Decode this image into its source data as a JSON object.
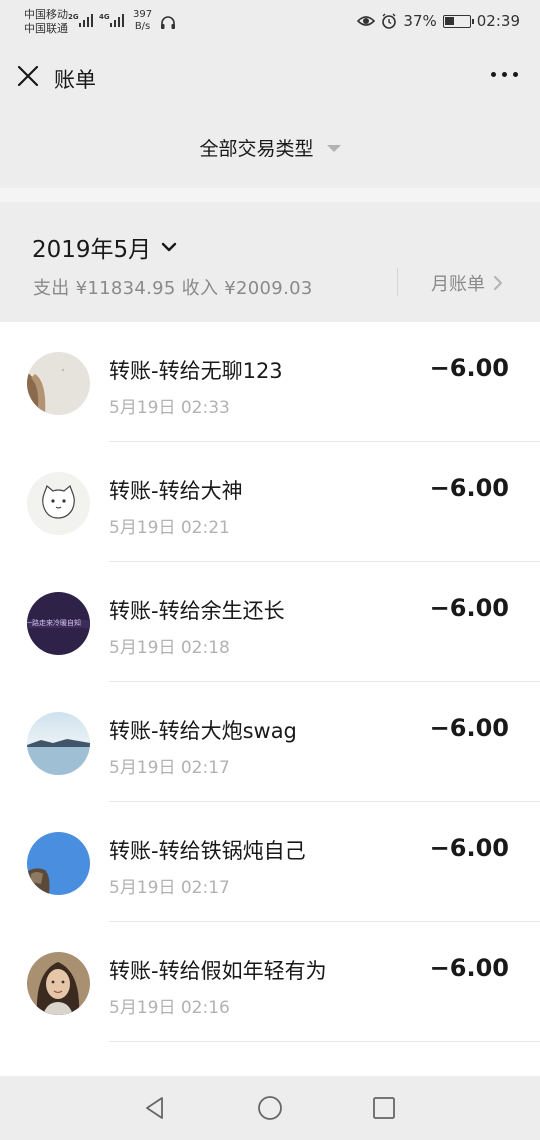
{
  "status_bar": {
    "carrier1": "中国移动",
    "carrier2": "中国联通",
    "net1": "2G",
    "net2": "4G",
    "speed_value": "397",
    "speed_unit": "B/s",
    "battery": "37%",
    "time": "02:39",
    "battery_level": 0.37
  },
  "nav": {
    "title": "账单",
    "close_icon": "close-icon",
    "more_icon": "more-icon"
  },
  "filter": {
    "label": "全部交易类型"
  },
  "month": {
    "label": "2019年5月",
    "summary": "支出 ¥11834.95 收入 ¥2009.03",
    "bill_link": "月账单"
  },
  "transactions": [
    {
      "title": "转账-转给无聊123",
      "time": "5月19日 02:33",
      "amount": "−6.00"
    },
    {
      "title": "转账-转给大神",
      "time": "5月19日 02:21",
      "amount": "−6.00"
    },
    {
      "title": "转账-转给余生还长",
      "time": "5月19日 02:18",
      "amount": "−6.00",
      "avatar_text": "一路走来冷暖自知"
    },
    {
      "title": "转账-转给大炮swag",
      "time": "5月19日 02:17",
      "amount": "−6.00"
    },
    {
      "title": "转账-转给铁锅炖自己",
      "time": "5月19日 02:17",
      "amount": "−6.00"
    },
    {
      "title": "转账-转给假如年轻有为",
      "time": "5月19日 02:16",
      "amount": "−6.00"
    }
  ],
  "colors": {
    "background": "#ededed",
    "text_primary": "#191919",
    "text_secondary": "#8a8a8a",
    "text_tertiary": "#b2b2b2"
  }
}
